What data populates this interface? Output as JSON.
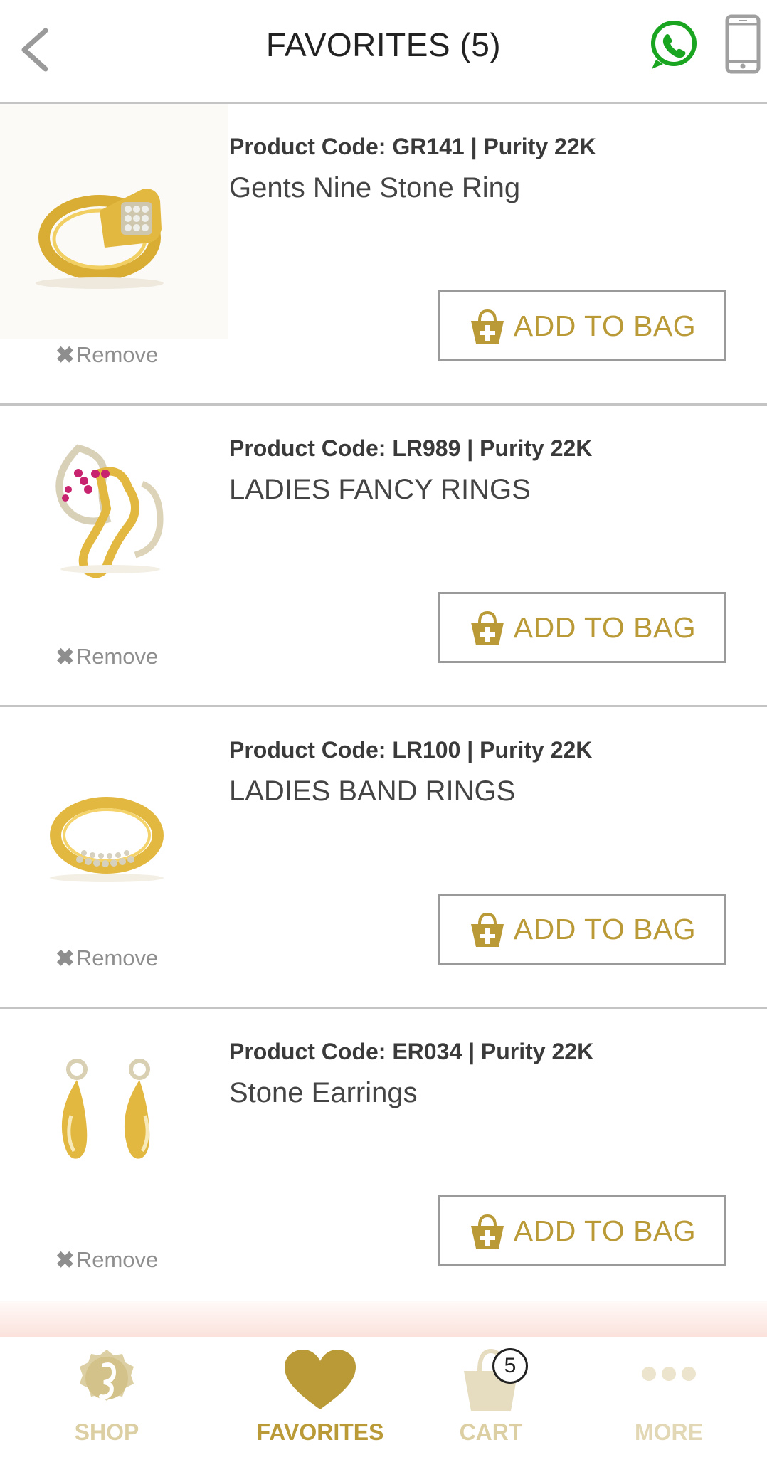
{
  "header": {
    "title": "FAVORITES (5)",
    "back_icon": "chevron-left-icon",
    "whatsapp_icon": "whatsapp-icon",
    "phone_icon": "phone-icon"
  },
  "items": [
    {
      "code": "Product Code: GR141 | Purity 22K",
      "name": "Gents Nine Stone Ring",
      "remove": "Remove",
      "add": "ADD TO BAG"
    },
    {
      "code": "Product Code: LR989 | Purity 22K",
      "name": "LADIES FANCY RINGS",
      "remove": "Remove",
      "add": "ADD TO BAG"
    },
    {
      "code": "Product Code: LR100 | Purity 22K",
      "name": "LADIES BAND RINGS",
      "remove": "Remove",
      "add": "ADD TO BAG"
    },
    {
      "code": "Product Code: ER034 | Purity 22K",
      "name": "Stone Earrings",
      "remove": "Remove",
      "add": "ADD TO BAG"
    }
  ],
  "tabs": {
    "shop": "SHOP",
    "favorites": "FAVORITES",
    "cart": "CART",
    "more": "MORE",
    "cart_count": "5"
  },
  "colors": {
    "gold": "#b99a36",
    "gold_muted": "#dccfa3",
    "whatsapp": "#1aa521",
    "divider": "#c4c4c4"
  }
}
